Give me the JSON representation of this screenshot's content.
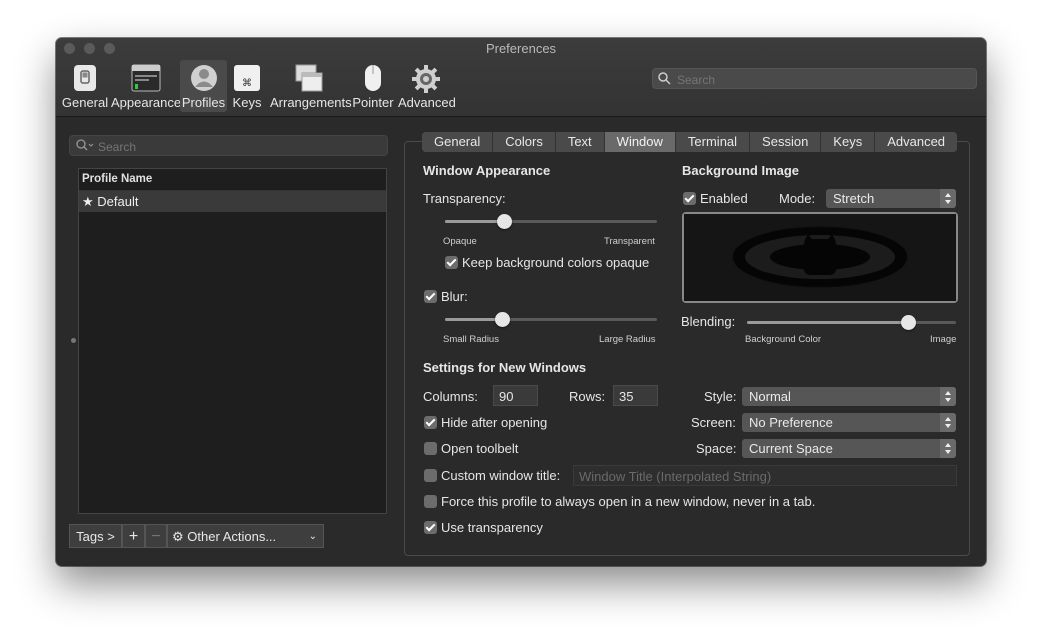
{
  "window": {
    "title": "Preferences"
  },
  "toolbar": {
    "items": [
      {
        "label": "General",
        "icon": "switch-icon"
      },
      {
        "label": "Appearance",
        "icon": "appearance-icon"
      },
      {
        "label": "Profiles",
        "icon": "person-icon",
        "active": true
      },
      {
        "label": "Keys",
        "icon": "command-key-icon"
      },
      {
        "label": "Arrangements",
        "icon": "arrangements-icon"
      },
      {
        "label": "Pointer",
        "icon": "mouse-icon"
      },
      {
        "label": "Advanced",
        "icon": "gear-icon"
      }
    ],
    "search_placeholder": "Search"
  },
  "sidebar": {
    "search_placeholder": "Search",
    "table_header": "Profile Name",
    "profiles": [
      {
        "name": "Default",
        "icon": "star-icon",
        "selected": true
      }
    ],
    "tags_label": "Tags >",
    "add_label": "+",
    "remove_label": "−",
    "other_actions_label": "Other Actions..."
  },
  "tabs": [
    "General",
    "Colors",
    "Text",
    "Window",
    "Terminal",
    "Session",
    "Keys",
    "Advanced"
  ],
  "active_tab": "Window",
  "window_appearance": {
    "header": "Window Appearance",
    "transparency_label": "Transparency:",
    "transparency_value": 0.28,
    "opaque_label": "Opaque",
    "transparent_label": "Transparent",
    "keep_bg_opaque_label": "Keep background colors opaque",
    "keep_bg_opaque": true,
    "blur_label": "Blur:",
    "blur": true,
    "blur_value": 0.27,
    "small_radius_label": "Small Radius",
    "large_radius_label": "Large Radius"
  },
  "background_image": {
    "header": "Background Image",
    "enabled_label": "Enabled",
    "enabled": true,
    "mode_label": "Mode:",
    "mode_value": "Stretch",
    "blending_label": "Blending:",
    "blending_value": 0.77,
    "bg_color_label": "Background Color",
    "image_label": "Image"
  },
  "new_windows": {
    "header": "Settings for New Windows",
    "columns_label": "Columns:",
    "columns_value": "90",
    "rows_label": "Rows:",
    "rows_value": "35",
    "style_label": "Style:",
    "style_value": "Normal",
    "screen_label": "Screen:",
    "screen_value": "No Preference",
    "space_label": "Space:",
    "space_value": "Current Space",
    "hide_after_opening_label": "Hide after opening",
    "hide_after_opening": true,
    "open_toolbelt_label": "Open toolbelt",
    "open_toolbelt": false,
    "custom_title_label": "Custom window title:",
    "custom_title": false,
    "custom_title_placeholder": "Window Title (Interpolated String)",
    "force_new_window_label": "Force this profile to always open in a new window, never in a tab.",
    "force_new_window": false,
    "use_transparency_label": "Use transparency",
    "use_transparency": true
  }
}
